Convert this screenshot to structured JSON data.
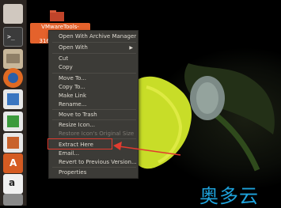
{
  "launcher": {
    "items": [
      {
        "name": "terminal-icon"
      },
      {
        "name": "files-icon"
      },
      {
        "name": "firefox-icon"
      },
      {
        "name": "writer-icon"
      },
      {
        "name": "calc-icon"
      },
      {
        "name": "impress-icon"
      },
      {
        "name": "software-center-icon"
      },
      {
        "name": "amazon-icon"
      },
      {
        "name": "settings-icon"
      }
    ]
  },
  "desktop": {
    "file_label_line1": "VMwareTools-",
    "file_label_line2": "10.0.1-3160059.tar.gz"
  },
  "context_menu": {
    "items": [
      {
        "label": "Open With Archive Manager",
        "disabled": false
      },
      {
        "label": "Open With",
        "disabled": false,
        "submenu": true
      },
      {
        "label": "Cut",
        "disabled": false
      },
      {
        "label": "Copy",
        "disabled": false
      },
      {
        "label": "Move To...",
        "disabled": false
      },
      {
        "label": "Copy To...",
        "disabled": false
      },
      {
        "label": "Make Link",
        "disabled": false
      },
      {
        "label": "Rename...",
        "disabled": false
      },
      {
        "label": "Move to Trash",
        "disabled": false
      },
      {
        "label": "Resize Icon...",
        "disabled": false
      },
      {
        "label": "Restore Icon's Original Size",
        "disabled": true
      },
      {
        "label": "Extract Here",
        "disabled": false
      },
      {
        "label": "Email...",
        "disabled": false
      },
      {
        "label": "Revert to Previous Version...",
        "disabled": false
      },
      {
        "label": "Properties",
        "disabled": false
      }
    ],
    "submenu_arrow": "▶"
  },
  "annotation": {
    "highlight_color": "#e23b2f"
  },
  "watermark": {
    "text": "奥多云",
    "color": "#1ea3dc"
  }
}
